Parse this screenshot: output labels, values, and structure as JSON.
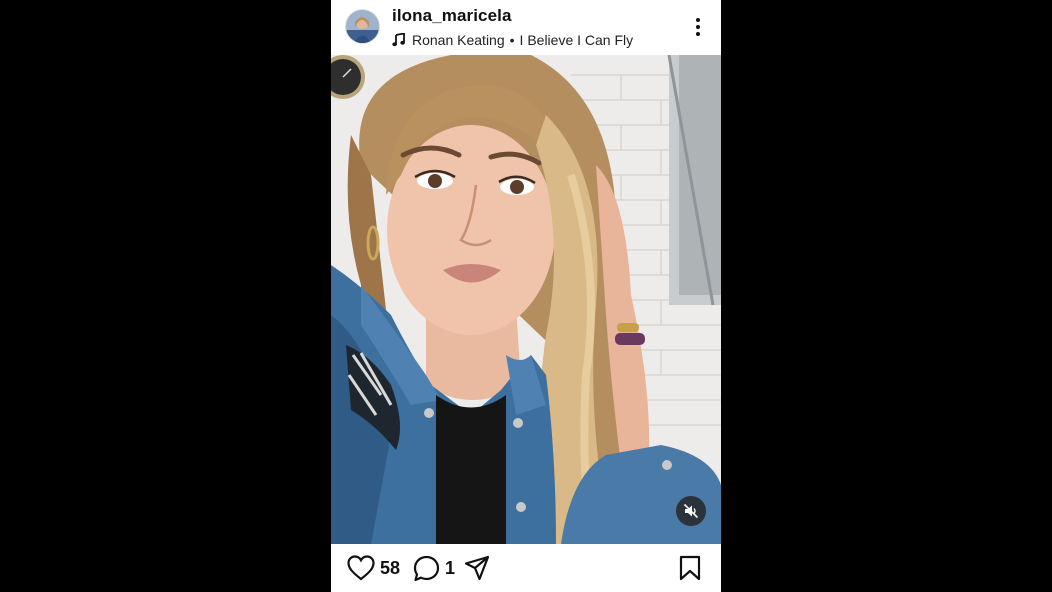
{
  "post": {
    "username": "ilona_maricela",
    "music": {
      "artist": "Ronan Keating",
      "separator": "•",
      "song": "I Believe I Can Fly"
    },
    "likes_count": "58",
    "comments_count": "1"
  },
  "icons": {
    "avatar": "profile-avatar",
    "music": "music-note-icon",
    "more": "more-vertical-icon",
    "mute": "muted-speaker-icon",
    "like": "heart-outline-icon",
    "comment": "comment-bubble-icon",
    "share": "paper-plane-icon",
    "save": "bookmark-outline-icon"
  },
  "colors": {
    "background": "#000000",
    "post_background": "#ffffff",
    "text": "#111111",
    "mute_badge": "#262626"
  }
}
